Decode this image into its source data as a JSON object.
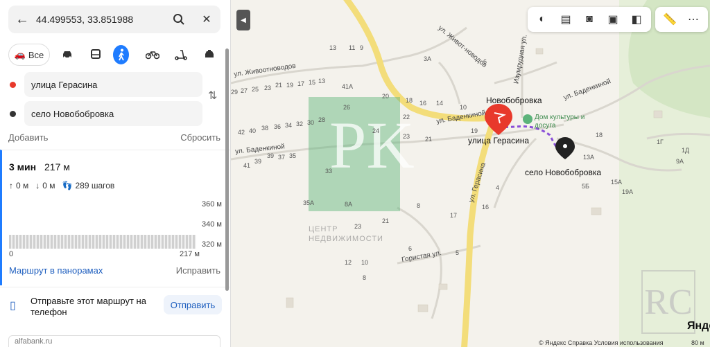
{
  "search": {
    "query": "44.499553, 33.851988"
  },
  "modes": {
    "all_label": "Все"
  },
  "waypoints": {
    "from": "улица Герасина",
    "to": "село Новобобровка"
  },
  "actions": {
    "add": "Добавить",
    "reset": "Сбросить"
  },
  "route": {
    "time": "3 мин",
    "distance": "217 м",
    "ascent": "0 м",
    "descent": "0 м",
    "steps": "289 шагов",
    "elev_labels": [
      "360 м",
      "340 м",
      "320 м"
    ],
    "axis_start": "0",
    "axis_end": "217 м",
    "panorama_link": "Маршрут в панорамах",
    "fix_link": "Исправить"
  },
  "send": {
    "text": "Отправьте этот маршрут на телефон",
    "button": "Отправить"
  },
  "ad": {
    "text": "alfabank.ru"
  },
  "map": {
    "watermark_caption": "ЦЕНТР НЕДВИЖИМОСТИ",
    "village": "Новобобровка",
    "start_label": "улица Герасина",
    "end_label": "село Новобобровка",
    "poi": "Дом культуры и досуга",
    "streets": [
      "ул. Живоотноводов",
      "ул. Живот-новодов",
      "ул. Баденкиной",
      "ул. Баденкиной",
      "ул. Баденкиной",
      "ул. Герасина",
      "Изумрудная ул.",
      "Гористая ул."
    ],
    "houses": [
      "13",
      "11",
      "9",
      "3А",
      "6",
      "41А",
      "20",
      "18",
      "16",
      "14",
      "10",
      "29",
      "27",
      "25",
      "23",
      "21",
      "19",
      "17",
      "15",
      "13",
      "11",
      "26",
      "24",
      "22",
      "23",
      "21",
      "19",
      "42",
      "40",
      "38",
      "36",
      "34",
      "32",
      "30",
      "28",
      "39",
      "37",
      "35",
      "33",
      "31",
      "29",
      "27",
      "43",
      "41",
      "39",
      "37",
      "35",
      "35А",
      "8А",
      "8",
      "17",
      "23",
      "21",
      "6",
      "12",
      "10",
      "8",
      "5",
      "4",
      "3",
      "2",
      "1",
      "9",
      "15",
      "13",
      "11",
      "16",
      "1Г",
      "1Д",
      "9А",
      "13А",
      "15А",
      "19А",
      "5Б",
      "18"
    ],
    "copyright": "© Яндекс   Справка   Условия использования",
    "brand": "Яндекс",
    "scale": "80 м"
  },
  "colors": {
    "accent": "#1f7cff",
    "route": "#8a4fd8",
    "start_pin": "#e8392b",
    "link": "#1f5fbf"
  }
}
